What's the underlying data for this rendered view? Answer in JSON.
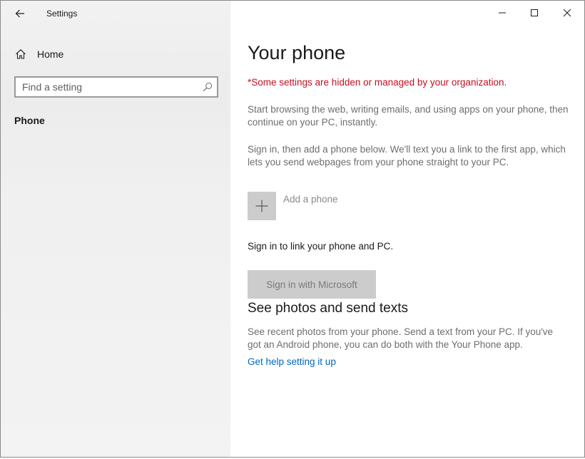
{
  "window": {
    "title": "Settings",
    "controls": {
      "minimize": "minimize",
      "maximize": "maximize",
      "close": "close"
    }
  },
  "sidebar": {
    "home_label": "Home",
    "search": {
      "placeholder": "Find a setting",
      "value": ""
    },
    "items": [
      {
        "label": "Phone",
        "selected": true
      }
    ]
  },
  "main": {
    "title": "Your phone",
    "org_notice": "*Some settings are hidden or managed by your organization.",
    "intro": "Start browsing the web, writing emails, and using apps on your phone, then continue on your PC, instantly.",
    "signin_intro": "Sign in, then add a phone below. We'll text you a link to the first app, which lets you send webpages from your phone straight to your PC.",
    "add_phone_label": "Add a phone",
    "signin_prompt": "Sign in to link your phone and PC.",
    "signin_button": "Sign in with Microsoft",
    "photos_section": {
      "title": "See photos and send texts",
      "description": "See recent photos from your phone. Send a text from your PC. If you've got an Android phone, you can do both with the Your Phone app.",
      "link": "Get help setting it up"
    }
  },
  "colors": {
    "notice_red": "#c50f1f",
    "link_blue": "#0067c0",
    "disabled_gray": "#cccccc"
  },
  "icons": [
    "back-arrow-icon",
    "home-icon",
    "search-icon",
    "plus-icon",
    "minimize-icon",
    "maximize-icon",
    "close-icon"
  ]
}
